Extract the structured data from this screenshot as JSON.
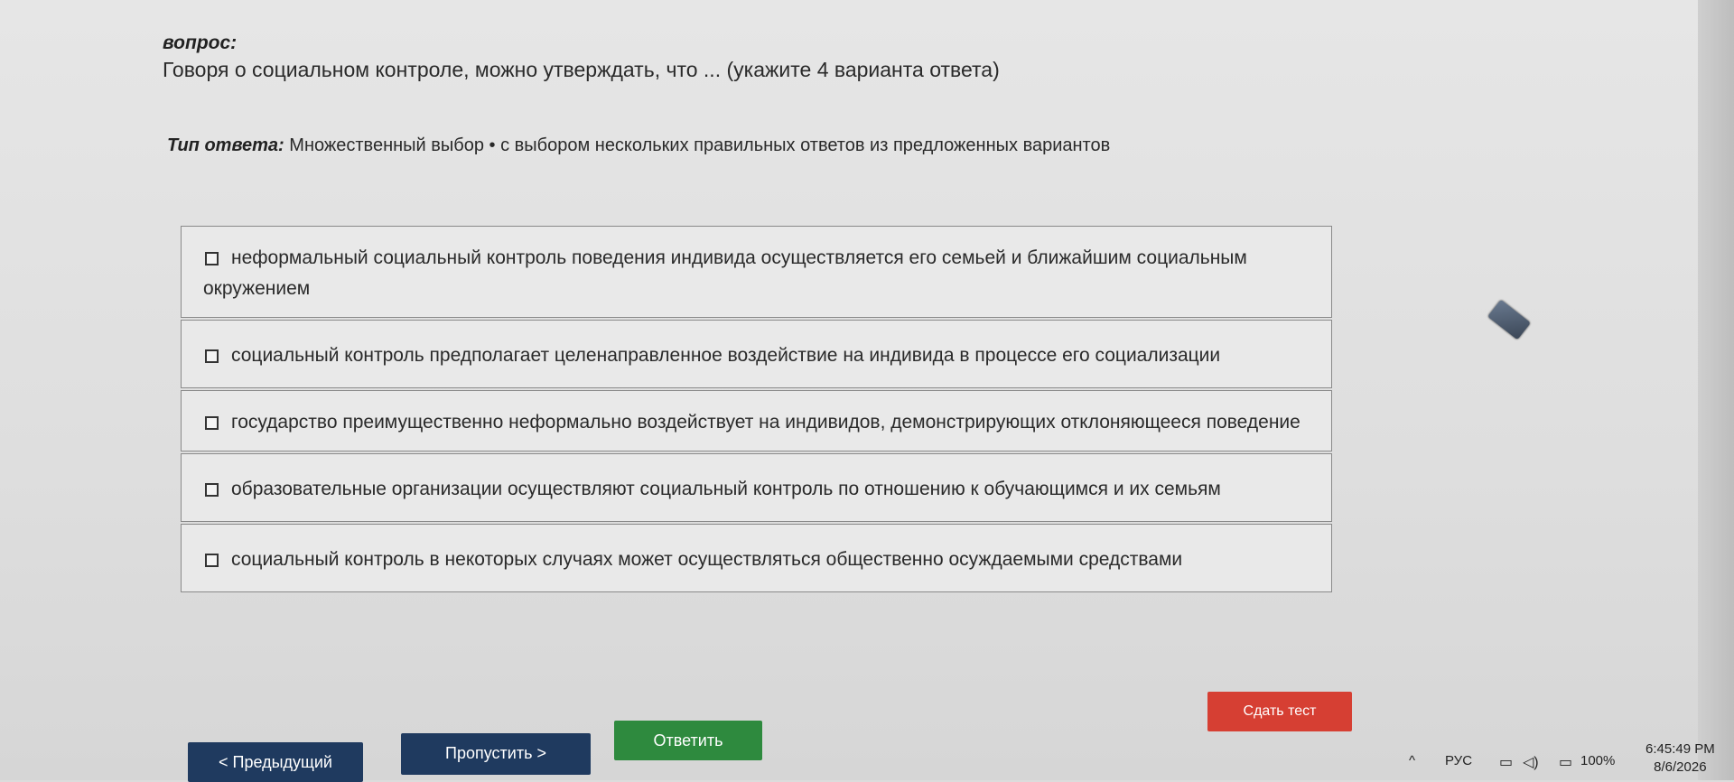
{
  "question": {
    "label": "вопрос:",
    "text": "Говоря о социальном контроле, можно утверждать, что ... (укажите 4 варианта ответа)"
  },
  "answer_type": {
    "label": "Тип ответа:",
    "value": "Множественный выбор • с выбором нескольких правильных ответов из предложенных вариантов"
  },
  "options": [
    {
      "text": "неформальный социальный контроль поведения индивида осуществляется его семьей и ближайшим социальным окружением",
      "checked": false
    },
    {
      "text": "социальный контроль предполагает целенаправленное воздействие на индивида в процессе его социализации",
      "checked": false
    },
    {
      "text": "государство преимущественно неформально воздействует на индивидов, демонстрирующих отклоняющееся поведение",
      "checked": false
    },
    {
      "text": "образовательные организации осуществляют социальный контроль по отношению к обучающимся и их семьям",
      "checked": false
    },
    {
      "text": "социальный контроль в некоторых случаях может осуществляться общественно осуждаемыми средствами",
      "checked": false
    }
  ],
  "buttons": {
    "prev": "< Предыдущий",
    "skip": "Пропустить >",
    "answer": "Ответить",
    "submit": "Сдать тест"
  },
  "taskbar": {
    "chevron": "^",
    "lang": "РУС",
    "battery": "100%",
    "time": "6:45:49 PM",
    "date": "8/6/2026",
    "icons": [
      "chevron-up-icon",
      "network-icon",
      "volume-icon",
      "battery-icon"
    ]
  },
  "colors": {
    "nav_button": "#1f3a5f",
    "answer_button": "#2e8a3e",
    "submit_button": "#d63f33"
  }
}
